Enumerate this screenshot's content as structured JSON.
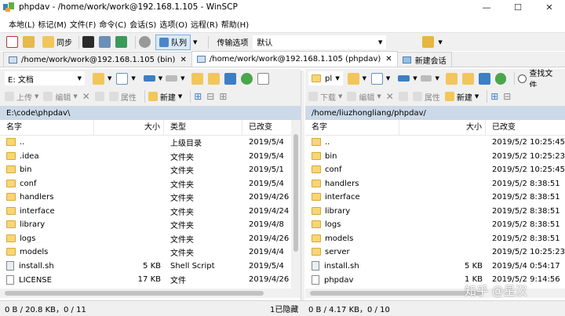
{
  "window": {
    "title": "phpdav - /home/work/work@192.168.1.105 - WinSCP",
    "minimize": "—",
    "maximize": "☐",
    "close": "✕"
  },
  "menu": [
    "本地(L)",
    "标记(M)",
    "文件(F)",
    "命令(C)",
    "会话(S)",
    "选项(O)",
    "远程(R)",
    "帮助(H)"
  ],
  "toolbar": {
    "sync_label": "同步",
    "queue_label": "队列",
    "transfer_options_label": "传输选项",
    "transfer_preset": "默认"
  },
  "tabs": [
    {
      "label": "/home/work/work@192.168.1.105 (bin)",
      "close": "✕"
    },
    {
      "label": "/home/work/work@192.168.1.105 (phpdav)",
      "close": "✕"
    },
    {
      "label": "新建会话"
    }
  ],
  "local": {
    "drive": "E: 文档",
    "ops": {
      "upload": "上传",
      "edit": "编辑",
      "properties": "属性",
      "new": "新建"
    },
    "path": "E:\\code\\phpdav\\",
    "columns": {
      "name": "名字",
      "size": "大小",
      "type": "类型",
      "modified": "已改变"
    },
    "rows": [
      {
        "name": "..",
        "size": "",
        "type": "上级目录",
        "modified": "2019/5/4",
        "kind": "up"
      },
      {
        "name": ".idea",
        "size": "",
        "type": "文件夹",
        "modified": "2019/5/4",
        "kind": "folder"
      },
      {
        "name": "bin",
        "size": "",
        "type": "文件夹",
        "modified": "2019/5/1",
        "kind": "folder"
      },
      {
        "name": "conf",
        "size": "",
        "type": "文件夹",
        "modified": "2019/5/4",
        "kind": "folder"
      },
      {
        "name": "handlers",
        "size": "",
        "type": "文件夹",
        "modified": "2019/4/26",
        "kind": "folder"
      },
      {
        "name": "interface",
        "size": "",
        "type": "文件夹",
        "modified": "2019/4/24",
        "kind": "folder"
      },
      {
        "name": "library",
        "size": "",
        "type": "文件夹",
        "modified": "2019/4/8",
        "kind": "folder"
      },
      {
        "name": "logs",
        "size": "",
        "type": "文件夹",
        "modified": "2019/4/26",
        "kind": "folder"
      },
      {
        "name": "models",
        "size": "",
        "type": "文件夹",
        "modified": "2019/4/4",
        "kind": "folder"
      },
      {
        "name": "install.sh",
        "size": "5 KB",
        "type": "Shell Script",
        "modified": "2019/5/4",
        "kind": "script"
      },
      {
        "name": "LICENSE",
        "size": "17 KB",
        "type": "文件",
        "modified": "2019/4/26",
        "kind": "file"
      }
    ],
    "status": "0 B / 20.8 KB，0 / 11",
    "hidden": "1已隐藏"
  },
  "remote": {
    "dir": "pl",
    "ops": {
      "download": "下载",
      "edit": "编辑",
      "properties": "属性",
      "new": "新建",
      "find": "查找文件"
    },
    "path": "/home/liuzhongliang/phpdav/",
    "columns": {
      "name": "名字",
      "size": "大小",
      "modified": "已改变"
    },
    "rows": [
      {
        "name": "..",
        "size": "",
        "modified": "2019/5/2 10:25:45",
        "kind": "up"
      },
      {
        "name": "bin",
        "size": "",
        "modified": "2019/5/2 10:25:23",
        "kind": "folder"
      },
      {
        "name": "conf",
        "size": "",
        "modified": "2019/5/2 10:25:45",
        "kind": "folder"
      },
      {
        "name": "handlers",
        "size": "",
        "modified": "2019/5/2 8:38:51",
        "kind": "folder"
      },
      {
        "name": "interface",
        "size": "",
        "modified": "2019/5/2 8:38:51",
        "kind": "folder"
      },
      {
        "name": "library",
        "size": "",
        "modified": "2019/5/2 8:38:51",
        "kind": "folder"
      },
      {
        "name": "logs",
        "size": "",
        "modified": "2019/5/2 8:38:51",
        "kind": "folder"
      },
      {
        "name": "models",
        "size": "",
        "modified": "2019/5/2 8:38:51",
        "kind": "folder"
      },
      {
        "name": "server",
        "size": "",
        "modified": "2019/5/2 10:25:23",
        "kind": "folder"
      },
      {
        "name": "install.sh",
        "size": "5 KB",
        "modified": "2019/5/4 0:54:17",
        "kind": "script"
      },
      {
        "name": "phpdav",
        "size": "1 KB",
        "modified": "2019/5/2 9:14:56",
        "kind": "file"
      }
    ],
    "status": "0 B / 4.17 KB，0 / 10"
  },
  "watermark": "知乎 @星汉",
  "colors": {
    "path_bar": "#ccd9e8",
    "toolbar_bg": "#f0f0f0",
    "folder": "#f7d674",
    "queue_highlight": "#dbe9f8"
  }
}
